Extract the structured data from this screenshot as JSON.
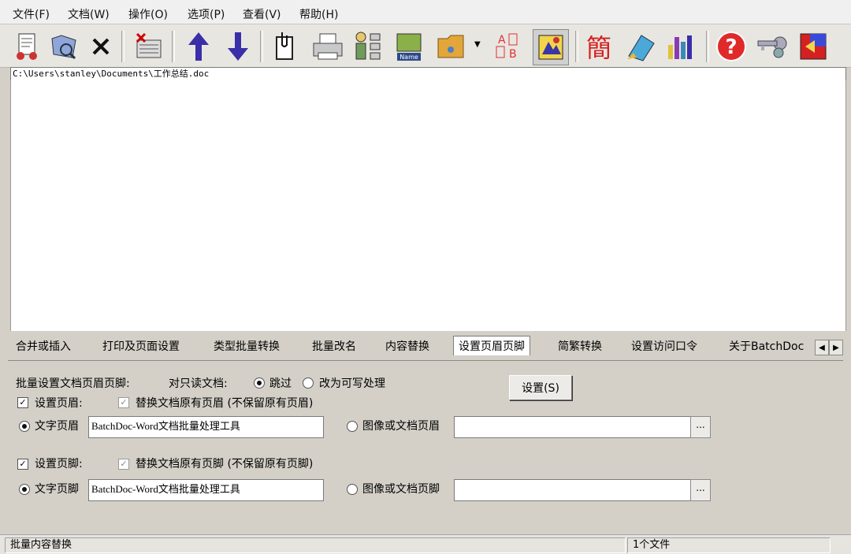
{
  "menu": {
    "file": "文件(F)",
    "document": "文档(W)",
    "operation": "操作(O)",
    "options": "选项(P)",
    "view": "查看(V)",
    "help": "帮助(H)"
  },
  "toolbar": {
    "icons": [
      "add-files-icon",
      "add-folder-icon",
      "delete-icon",
      "clear-list-icon",
      "move-up-icon",
      "move-down-icon",
      "attach-icon",
      "print-icon",
      "batch-icon",
      "rename-icon",
      "open-folder-icon",
      "replace-text-icon",
      "image-icon",
      "simplified-chinese-icon",
      "edit-icon",
      "chart-icon",
      "help-icon",
      "password-key-icon",
      "exit-icon"
    ],
    "jian_char": "簡",
    "name_label": "Name",
    "replace_a": "A",
    "replace_b": "B"
  },
  "path": "C:\\Users\\stanley\\Documents\\工作总结.doc",
  "tabs": [
    {
      "label": "合并或插入"
    },
    {
      "label": "打印及页面设置"
    },
    {
      "label": "类型批量转换"
    },
    {
      "label": "批量改名"
    },
    {
      "label": "内容替换"
    },
    {
      "label": "设置页眉页脚"
    },
    {
      "label": "简繁转换"
    },
    {
      "label": "设置访问口令"
    },
    {
      "label": "关于BatchDoc"
    }
  ],
  "panel": {
    "header_label": "批量设置文档页眉页脚:",
    "readonly_label": "对只读文档:",
    "skip_label": "跳过",
    "writable_label": "改为可写处理",
    "set_button": "设置(S)",
    "set_header_label": "设置页眉:",
    "replace_header_label": "替换文档原有页眉 (不保留原有页眉)",
    "text_header_label": "文字页眉",
    "text_header_value": "BatchDoc-Word文档批量处理工具",
    "image_header_label": "图像或文档页眉",
    "image_header_value": "",
    "set_footer_label": "设置页脚:",
    "replace_footer_label": "替换文档原有页脚 (不保留原有页脚)",
    "text_footer_label": "文字页脚",
    "text_footer_value": "BatchDoc-Word文档批量处理工具",
    "image_footer_label": "图像或文档页脚",
    "image_footer_value": "",
    "browse_label": "..."
  },
  "status": {
    "left": "批量内容替换",
    "right": "1个文件"
  }
}
